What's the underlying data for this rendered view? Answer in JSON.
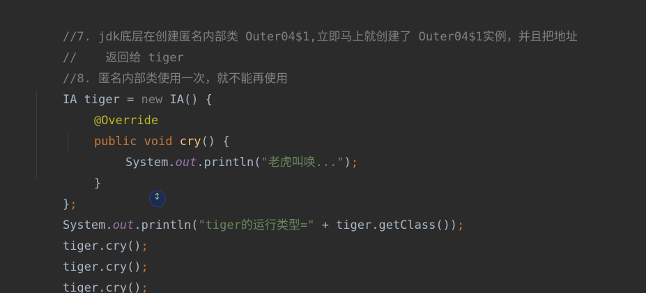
{
  "code": {
    "l1_comment": "//7. jdk底层在创建匿名内部类 Outer04$1,立即马上就创建了 Outer04$1实例，并且把地址",
    "l2_comment": "//    返回给 tiger",
    "l3_comment": "//8. 匿名内部类使用一次，就不能再使用",
    "l4_type": "IA tiger = ",
    "l4_new": "new",
    "l4_rest": " IA() {",
    "l5_annotation": "@Override",
    "l6_public": "public",
    "l6_void": " void ",
    "l6_method": "cry",
    "l6_rest": "() {",
    "l7_system": "System.",
    "l7_out": "out",
    "l7_println": ".println(",
    "l7_string": "\"老虎叫唤...\"",
    "l7_close": ")",
    "l7_semi": ";",
    "l8_brace": "}",
    "l9_brace": "}",
    "l9_semi": ";",
    "l10_system": "System.",
    "l10_out": "out",
    "l10_println": ".println(",
    "l10_string": "\"tiger的运行类型=\"",
    "l10_rest": " + tiger.getClass())",
    "l10_semi": ";",
    "l11_call": "tiger.cry()",
    "l11_semi": ";",
    "l12_call": "tiger.cry()",
    "l12_semi": ";",
    "l13_call": "tiger.cry()",
    "l13_semi": ";"
  },
  "colors": {
    "background": "#2b2b2b",
    "comment": "#808080",
    "keyword": "#cc7832",
    "annotation": "#bbb529",
    "method": "#ffc66d",
    "string": "#6a8759",
    "field": "#9876aa",
    "default": "#a9b7c6"
  },
  "cursor_icon": "mouse-cursor-icon"
}
